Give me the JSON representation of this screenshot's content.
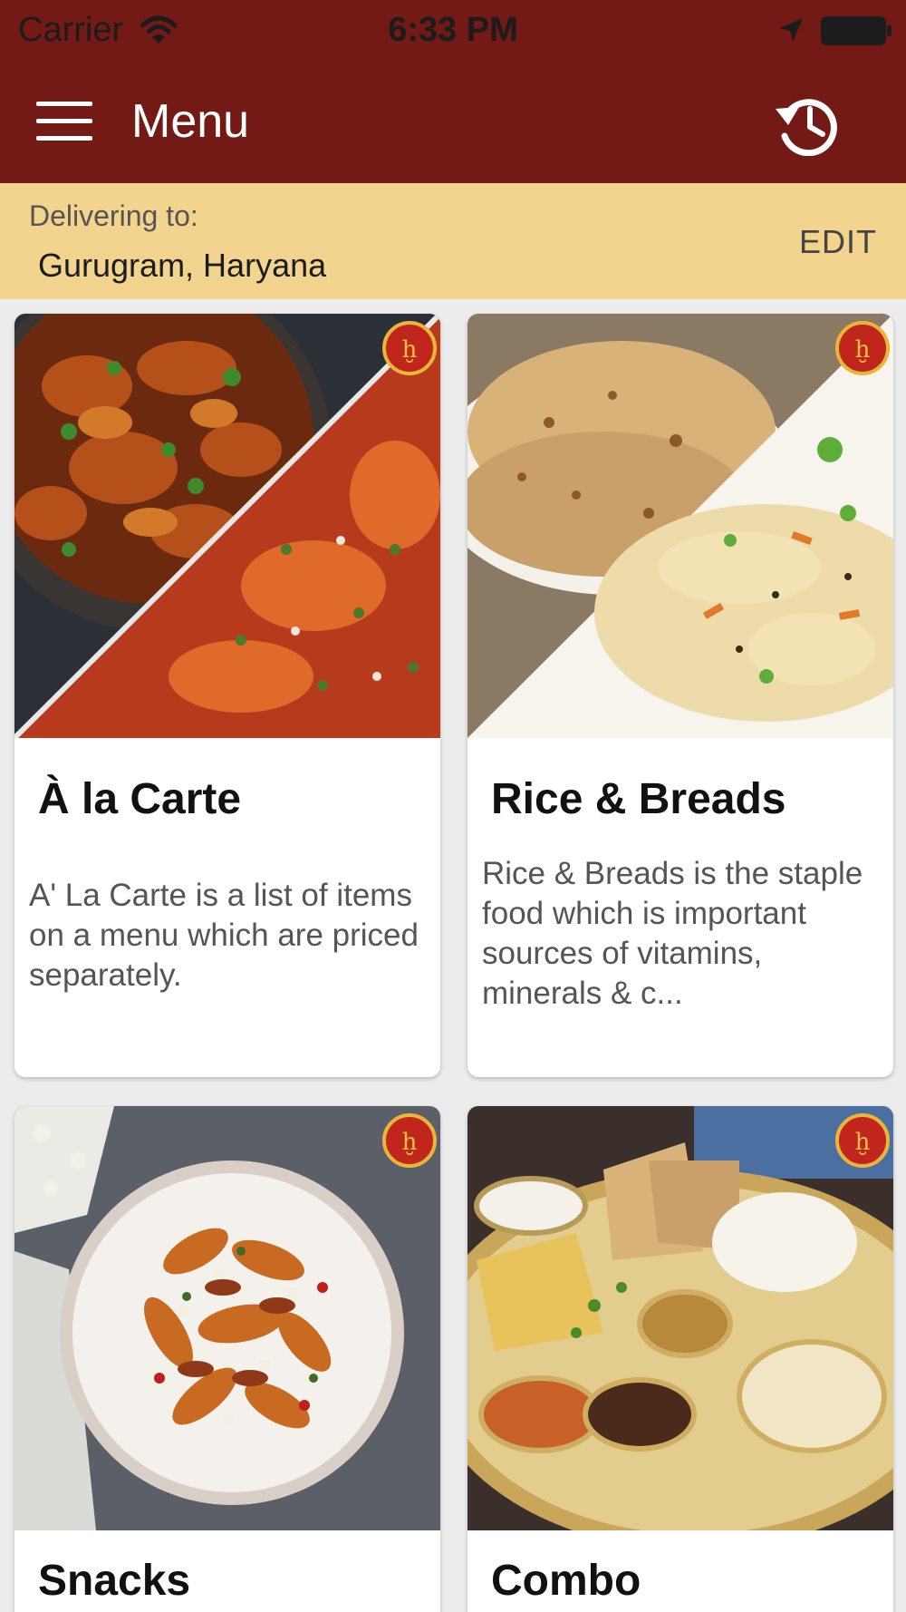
{
  "status_bar": {
    "carrier": "Carrier",
    "time": "6:33 PM",
    "icons": [
      "wifi-icon",
      "location-arrow-icon",
      "battery-icon"
    ]
  },
  "toolbar": {
    "title": "Menu",
    "icons": [
      "hamburger-menu-icon",
      "order-history-icon"
    ],
    "background": "#731a17"
  },
  "delivery": {
    "label": "Delivering to:",
    "location": "Gurugram, Haryana",
    "edit_label": "EDIT",
    "background": "#f2d48f"
  },
  "categories": [
    {
      "title": "À la Carte",
      "description": "A' La Carte is a list of items on a menu which are priced separately.",
      "image": "curry-dishes-photo"
    },
    {
      "title": "Rice & Breads",
      "description": "Rice & Breads is the staple food which is important sources of vitamins, minerals & c...",
      "image": "paratha-and-biryani-photo"
    },
    {
      "title": "Snacks",
      "description": "",
      "image": "roasted-vegetables-plate-photo"
    },
    {
      "title": "Combo",
      "description": "",
      "image": "thali-platter-photo"
    }
  ],
  "brand_badge_icon": "restaurant-logo-badge-icon"
}
